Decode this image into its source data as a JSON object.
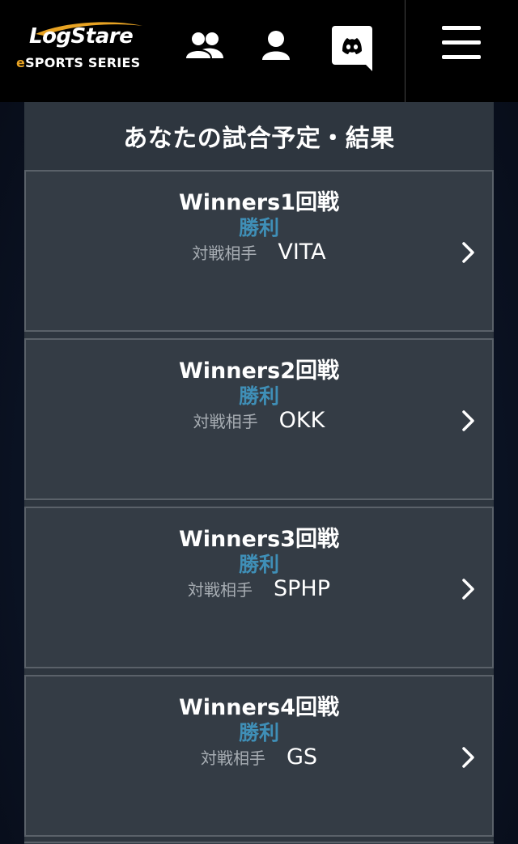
{
  "brand": {
    "logo_main": "LogStare",
    "logo_sub_e": "e",
    "logo_sub_rest": "SPORTS SERIES",
    "accent_color": "#e8a323"
  },
  "header": {
    "icons": [
      "team-icon",
      "user-icon",
      "discord-icon",
      "menu-icon"
    ]
  },
  "schedule": {
    "title": "あなたの試合予定・結果",
    "result_color": "#3f8fb7",
    "matches": [
      {
        "round": "Winners1回戦",
        "result": "勝利",
        "opponent_label": "対戦相手",
        "opponent": "VITA"
      },
      {
        "round": "Winners2回戦",
        "result": "勝利",
        "opponent_label": "対戦相手",
        "opponent": "OKK"
      },
      {
        "round": "Winners3回戦",
        "result": "勝利",
        "opponent_label": "対戦相手",
        "opponent": "SPHP"
      },
      {
        "round": "Winners4回戦",
        "result": "勝利",
        "opponent_label": "対戦相手",
        "opponent": "GS"
      }
    ]
  }
}
